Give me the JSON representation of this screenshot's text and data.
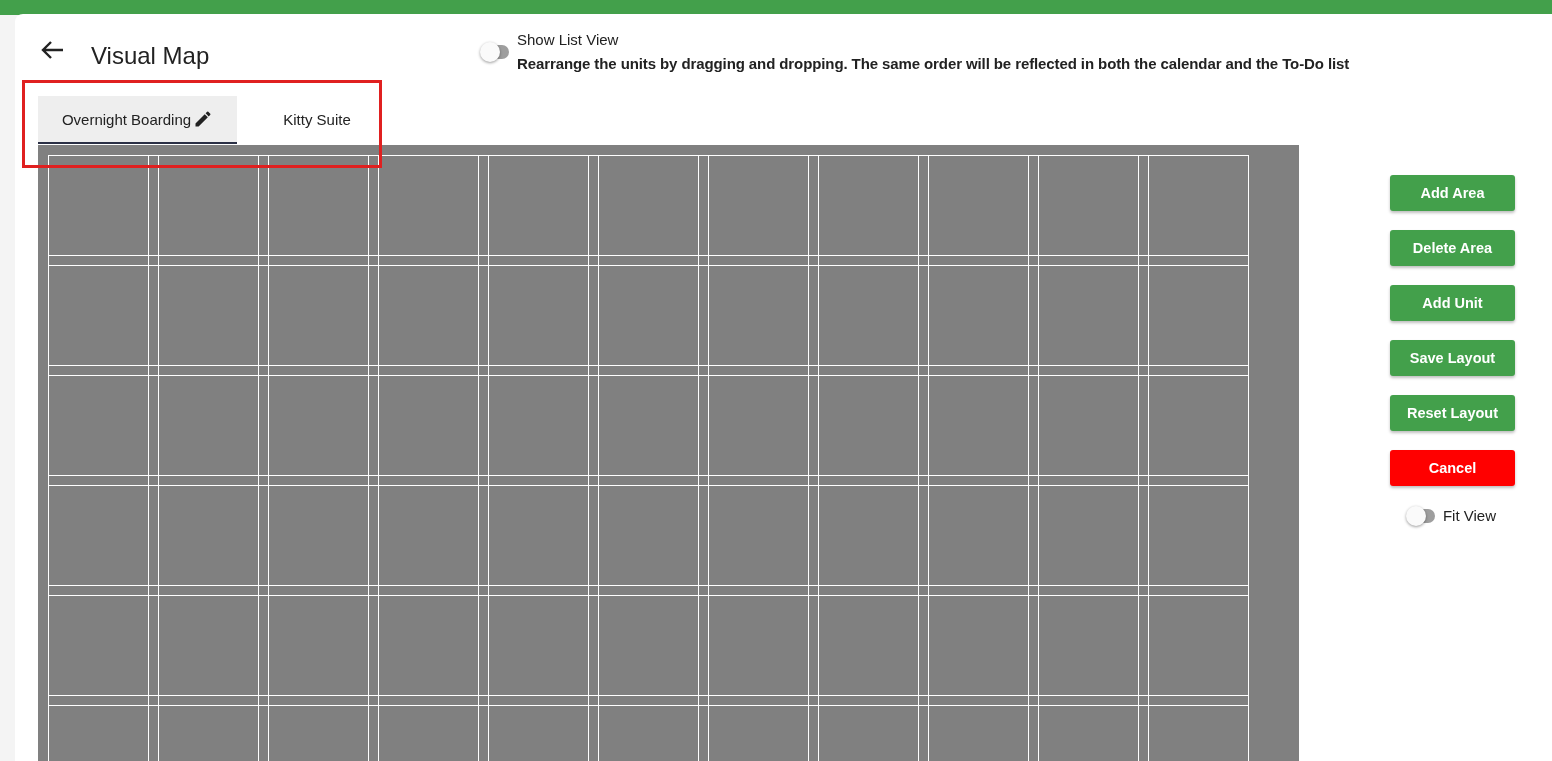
{
  "header": {
    "title": "Visual Map"
  },
  "list_view": {
    "label": "Show List View",
    "on": false,
    "description": "Rearrange the units by dragging and dropping. The same order will be reflected in both the calendar and the To-Do list"
  },
  "tabs": [
    {
      "label": "Overnight Boarding",
      "selected": true,
      "editable": true
    },
    {
      "label": "Kitty Suite",
      "selected": false,
      "editable": false
    }
  ],
  "buttons": [
    {
      "label": "Add Area",
      "kind": "primary"
    },
    {
      "label": "Delete Area",
      "kind": "primary"
    },
    {
      "label": "Add Unit",
      "kind": "primary"
    },
    {
      "label": "Save Layout",
      "kind": "primary"
    },
    {
      "label": "Reset Layout",
      "kind": "primary"
    },
    {
      "label": "Cancel",
      "kind": "danger"
    }
  ],
  "fit_view": {
    "label": "Fit View",
    "on": false
  }
}
